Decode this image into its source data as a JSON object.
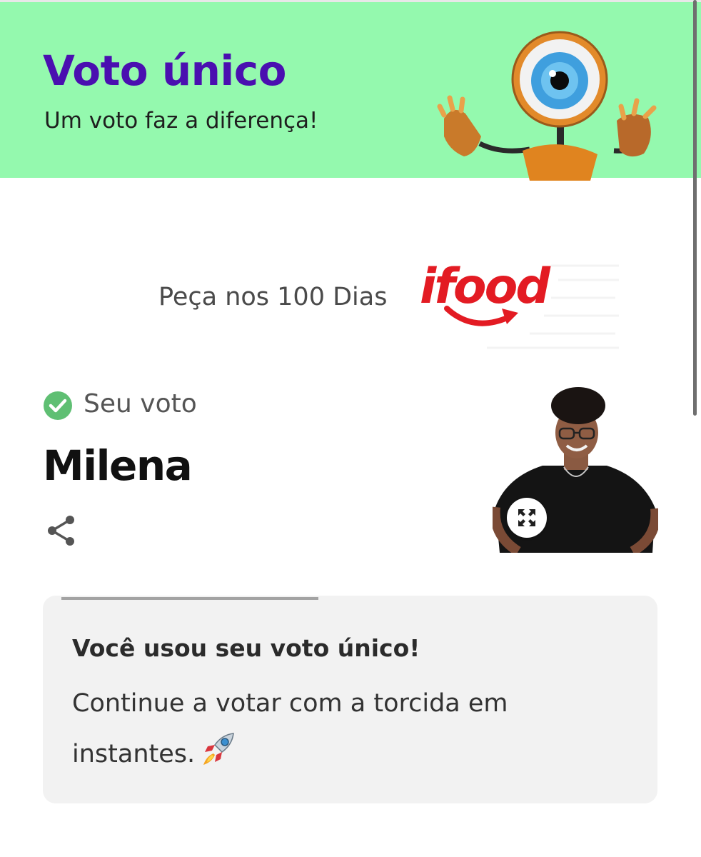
{
  "header": {
    "title": "Voto único",
    "subtitle": "Um voto faz a diferença!",
    "background_color": "#94f9ae",
    "title_color": "#4a0fb0",
    "mascot_icon": "big-brother-eye-mascot"
  },
  "sponsor": {
    "text": "Peça nos 100 Dias",
    "logo_text": "ifood",
    "logo_color": "#e31b23"
  },
  "vote": {
    "status_label": "Seu voto",
    "status_icon": "check-circle-icon",
    "status_color": "#5fbf73",
    "candidate_name": "Milena",
    "share_icon": "share-icon",
    "photo_expand_icon": "expand-icon"
  },
  "notice": {
    "title": "Você usou seu voto único!",
    "body": "Continue a votar com a torcida em instantes.",
    "emoji_icon": "rocket-icon"
  }
}
